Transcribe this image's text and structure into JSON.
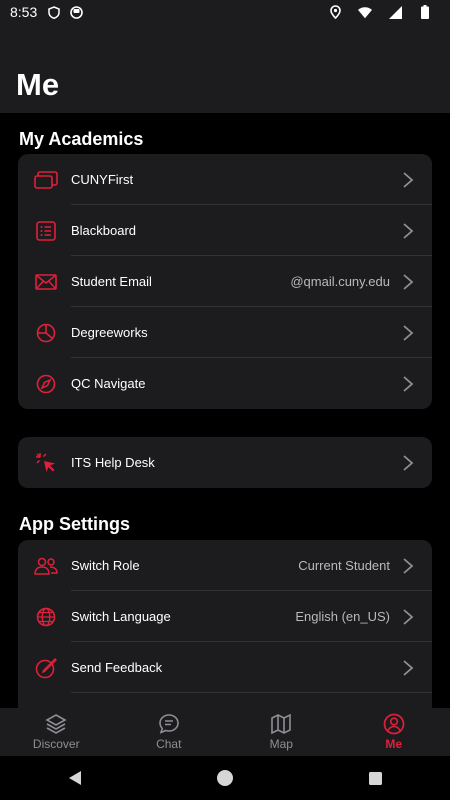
{
  "status_bar": {
    "time": "8:53"
  },
  "header": {
    "title": "Me"
  },
  "academics": {
    "title": "My Academics",
    "items": [
      {
        "label": "CUNYFirst",
        "value": "",
        "icon": "cards-icon"
      },
      {
        "label": "Blackboard",
        "value": "",
        "icon": "list-icon"
      },
      {
        "label": "Student Email",
        "value": "@qmail.cuny.edu",
        "icon": "mail-icon"
      },
      {
        "label": "Degreeworks",
        "value": "",
        "icon": "pie-chart-icon"
      },
      {
        "label": "QC Navigate",
        "value": "",
        "icon": "compass-icon"
      }
    ]
  },
  "help": {
    "label": "ITS Help Desk",
    "icon": "cursor-click-icon"
  },
  "settings": {
    "title": "App Settings",
    "items": [
      {
        "label": "Switch Role",
        "value": "Current Student",
        "icon": "users-icon"
      },
      {
        "label": "Switch Language",
        "value": "English (en_US)",
        "icon": "globe-icon"
      },
      {
        "label": "Send Feedback",
        "value": "",
        "icon": "feedback-icon"
      }
    ]
  },
  "bottom_nav": {
    "active": "Me",
    "items": [
      {
        "label": "Discover"
      },
      {
        "label": "Chat"
      },
      {
        "label": "Map"
      },
      {
        "label": "Me"
      }
    ]
  },
  "colors": {
    "accent": "#e0203a",
    "card": "#1c1c1e",
    "background": "#000000"
  }
}
